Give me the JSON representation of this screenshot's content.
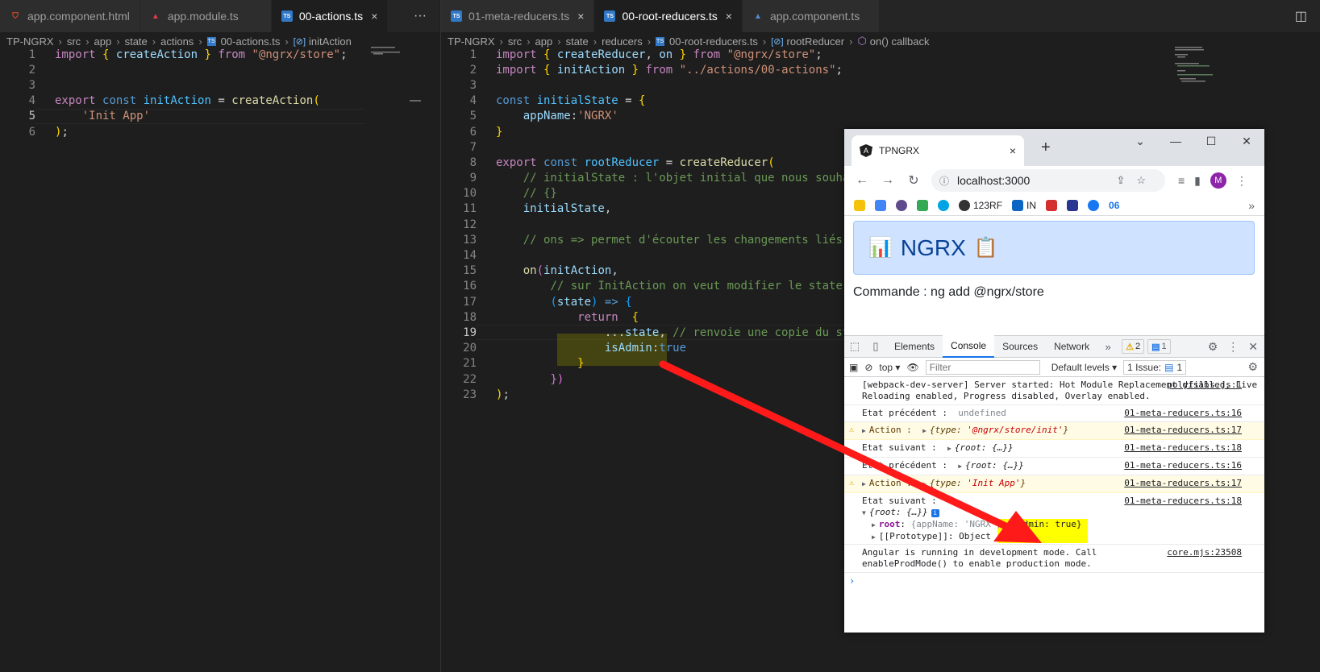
{
  "left_pane": {
    "tabs": [
      {
        "label": "app.component.html",
        "icon": "html-file-icon"
      },
      {
        "label": "app.module.ts",
        "icon": "angular-file-icon"
      },
      {
        "label": "00-actions.ts",
        "icon": "ts-file-icon",
        "active": true,
        "close": "×"
      }
    ],
    "more_actions": "···",
    "breadcrumb": [
      "TP-NGRX",
      "src",
      "app",
      "state",
      "actions",
      "00-actions.ts",
      "initAction"
    ],
    "lines": [
      "1",
      "2",
      "3",
      "4",
      "5",
      "6"
    ]
  },
  "right_pane": {
    "tabs": [
      {
        "label": "01-meta-reducers.ts",
        "icon": "ts-file-icon",
        "close": "×"
      },
      {
        "label": "00-root-reducers.ts",
        "icon": "ts-file-icon",
        "active": true,
        "close": "×"
      },
      {
        "label": "app.component.ts",
        "icon": "angular-file-icon"
      }
    ],
    "breadcrumb": [
      "TP-NGRX",
      "src",
      "app",
      "state",
      "reducers",
      "00-root-reducers.ts",
      "rootReducer",
      "on() callback"
    ],
    "lines": [
      "1",
      "2",
      "3",
      "4",
      "5",
      "6",
      "7",
      "8",
      "9",
      "10",
      "11",
      "12",
      "13",
      "14",
      "15",
      "16",
      "17",
      "18",
      "19",
      "20",
      "21",
      "22",
      "23"
    ]
  },
  "browser": {
    "tab_title": "TPNGRX",
    "tab_close": "×",
    "new_tab": "+",
    "url": "localhost:3000",
    "avatar_letter": "M",
    "bookmarks": [
      "123RF",
      "IN",
      "06"
    ],
    "page": {
      "header": "NGRX",
      "command": "Commande : ng add @ngrx/store"
    },
    "devtools": {
      "tabs": [
        "Elements",
        "Console",
        "Sources",
        "Network"
      ],
      "active_tab": "Console",
      "warn_count": "2",
      "info_count": "1",
      "context": "top",
      "filter_placeholder": "Filter",
      "levels": "Default levels",
      "issues": "1 Issue:",
      "issues_count": "1",
      "messages": [
        {
          "text": "[webpack-dev-server] Server started: Hot Module Replacement disabled, Live Reloading enabled, Progress disabled, Overlay enabled.",
          "src": "polyfills.js:1"
        },
        {
          "label": "Etat précédent :",
          "value": "undefined",
          "src": "01-meta-reducers.ts:16"
        },
        {
          "label": "Action :",
          "value_key": "type",
          "value_str": "'@ngrx/store/init'",
          "src": "01-meta-reducers.ts:17",
          "warn": true
        },
        {
          "label": "Etat suivant :",
          "value": "{root: {…}}",
          "src": "01-meta-reducers.ts:18"
        },
        {
          "label": "Etat précédent :",
          "value": "{root: {…}}",
          "src": "01-meta-reducers.ts:16"
        },
        {
          "label": "Action :",
          "value_key": "type",
          "value_str": "'Init App'",
          "src": "01-meta-reducers.ts:17",
          "warn": true
        },
        {
          "label": "Etat suivant :",
          "value": "{root: {…}}",
          "src": "01-meta-reducers.ts:18",
          "expanded_root": "root",
          "expanded_app": "{appName: 'NGRX',",
          "expanded_admin": "isAdmin: true}",
          "proto": "[[Prototype]]: Object"
        },
        {
          "text": "Angular is running in development mode. Call enableProdMode() to enable production mode.",
          "src": "core.mjs:23508"
        }
      ],
      "prompt": "›"
    }
  },
  "colors": {
    "editor_bg": "#1e1e1e",
    "arrow": "#ff1a1a",
    "highlight": "#ffff00"
  }
}
